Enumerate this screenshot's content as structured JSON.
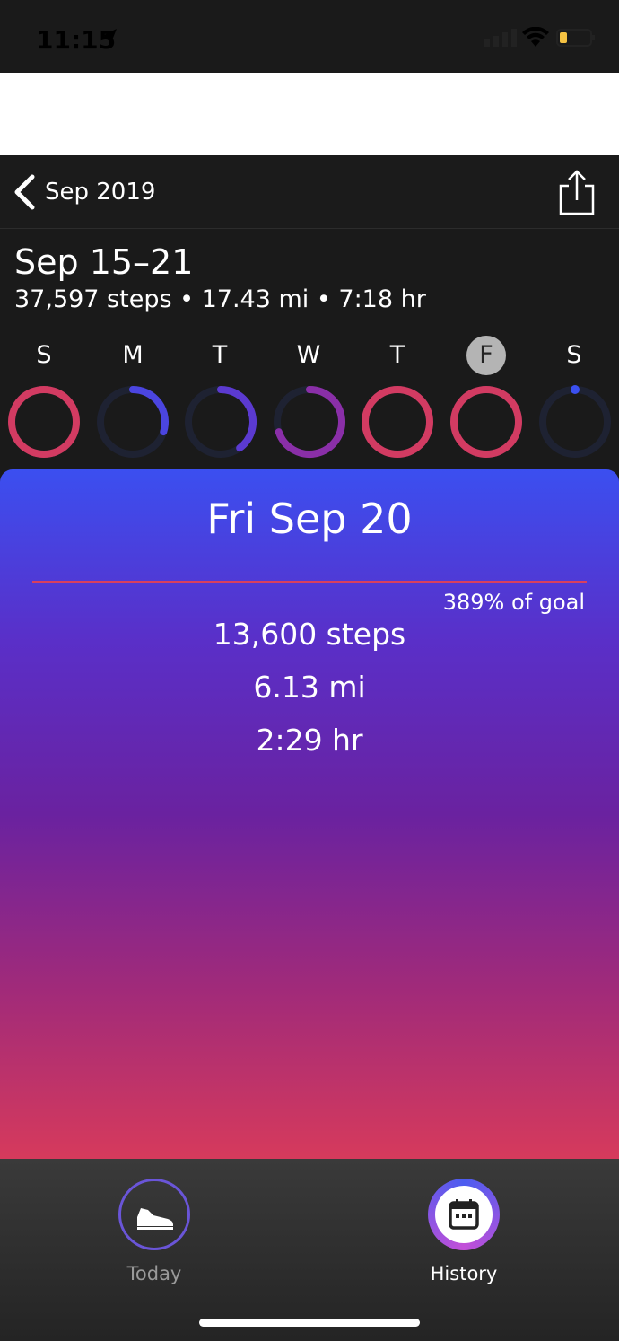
{
  "status_bar": {
    "time": "11:15"
  },
  "nav": {
    "back_label": "Sep 2019"
  },
  "week": {
    "title": "Sep 15–21",
    "summary": "37,597 steps • 17.43 mi • 7:18 hr"
  },
  "days": [
    {
      "letter": "S",
      "progress": 1.0,
      "color": "#d23b62",
      "selected": false
    },
    {
      "letter": "M",
      "progress": 0.3,
      "color": "#4b45e0",
      "selected": false
    },
    {
      "letter": "T",
      "progress": 0.4,
      "color": "#5b3ad0",
      "selected": false
    },
    {
      "letter": "W",
      "progress": 0.7,
      "color": "#8a2fa8",
      "selected": false
    },
    {
      "letter": "T",
      "progress": 1.0,
      "color": "#d23b62",
      "selected": false
    },
    {
      "letter": "F",
      "progress": 1.0,
      "color": "#d23b62",
      "selected": true
    },
    {
      "letter": "S",
      "progress": 0.01,
      "color": "#3b50f0",
      "selected": false
    }
  ],
  "detail": {
    "day_title": "Fri Sep 20",
    "goal_text": "389% of goal",
    "steps": "13,600 steps",
    "distance": "6.13 mi",
    "duration": "2:29 hr"
  },
  "tabs": {
    "today_label": "Today",
    "history_label": "History"
  },
  "colors": {
    "ring_track": "#1e2232",
    "accent_red": "#d8405e",
    "accent_blue": "#3b4ff0"
  }
}
